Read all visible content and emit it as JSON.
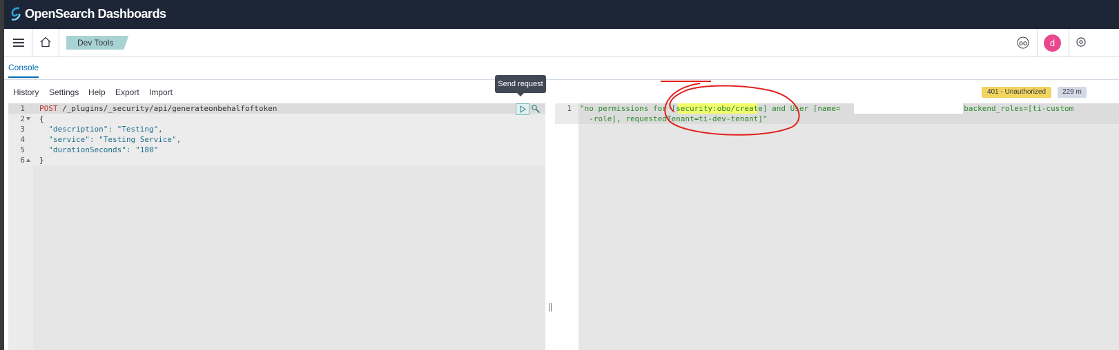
{
  "header": {
    "brand": "OpenSearch Dashboards"
  },
  "nav": {
    "breadcrumb": "Dev Tools",
    "avatar_initial": "d"
  },
  "tabs": [
    {
      "label": "Console"
    }
  ],
  "toolbar": {
    "history": "History",
    "settings": "Settings",
    "help": "Help",
    "export": "Export",
    "import": "Import"
  },
  "tooltip": {
    "send_request": "Send request"
  },
  "status": {
    "code": "401 - Unauthorized",
    "time": "229 m"
  },
  "request": {
    "method": "POST",
    "path": " /_plugins/_security/api/generateonbehalfoftoken",
    "line_numbers": [
      "1",
      "2",
      "3",
      "4",
      "5",
      "6"
    ],
    "body_lines": [
      "{",
      "  \"description\": \"Testing\",",
      "  \"service\": \"Testing Service\",",
      "  \"durationSeconds\": \"180\"",
      "}"
    ]
  },
  "response": {
    "line_numbers": [
      "1"
    ],
    "line1": "\"no permissions for [security:obo/create] and User [name=                           backend_roles=[ti-custom",
    "line2": "  -role], requestedTenant=ti-dev-tenant]\""
  },
  "colors": {
    "header_bg": "#1c2636",
    "accent": "#006bb8",
    "breadcrumb_bg": "#a8d3d2",
    "status_warning": "#f2d45f",
    "avatar": "#e7488e",
    "annotation_red": "#e0201c"
  }
}
